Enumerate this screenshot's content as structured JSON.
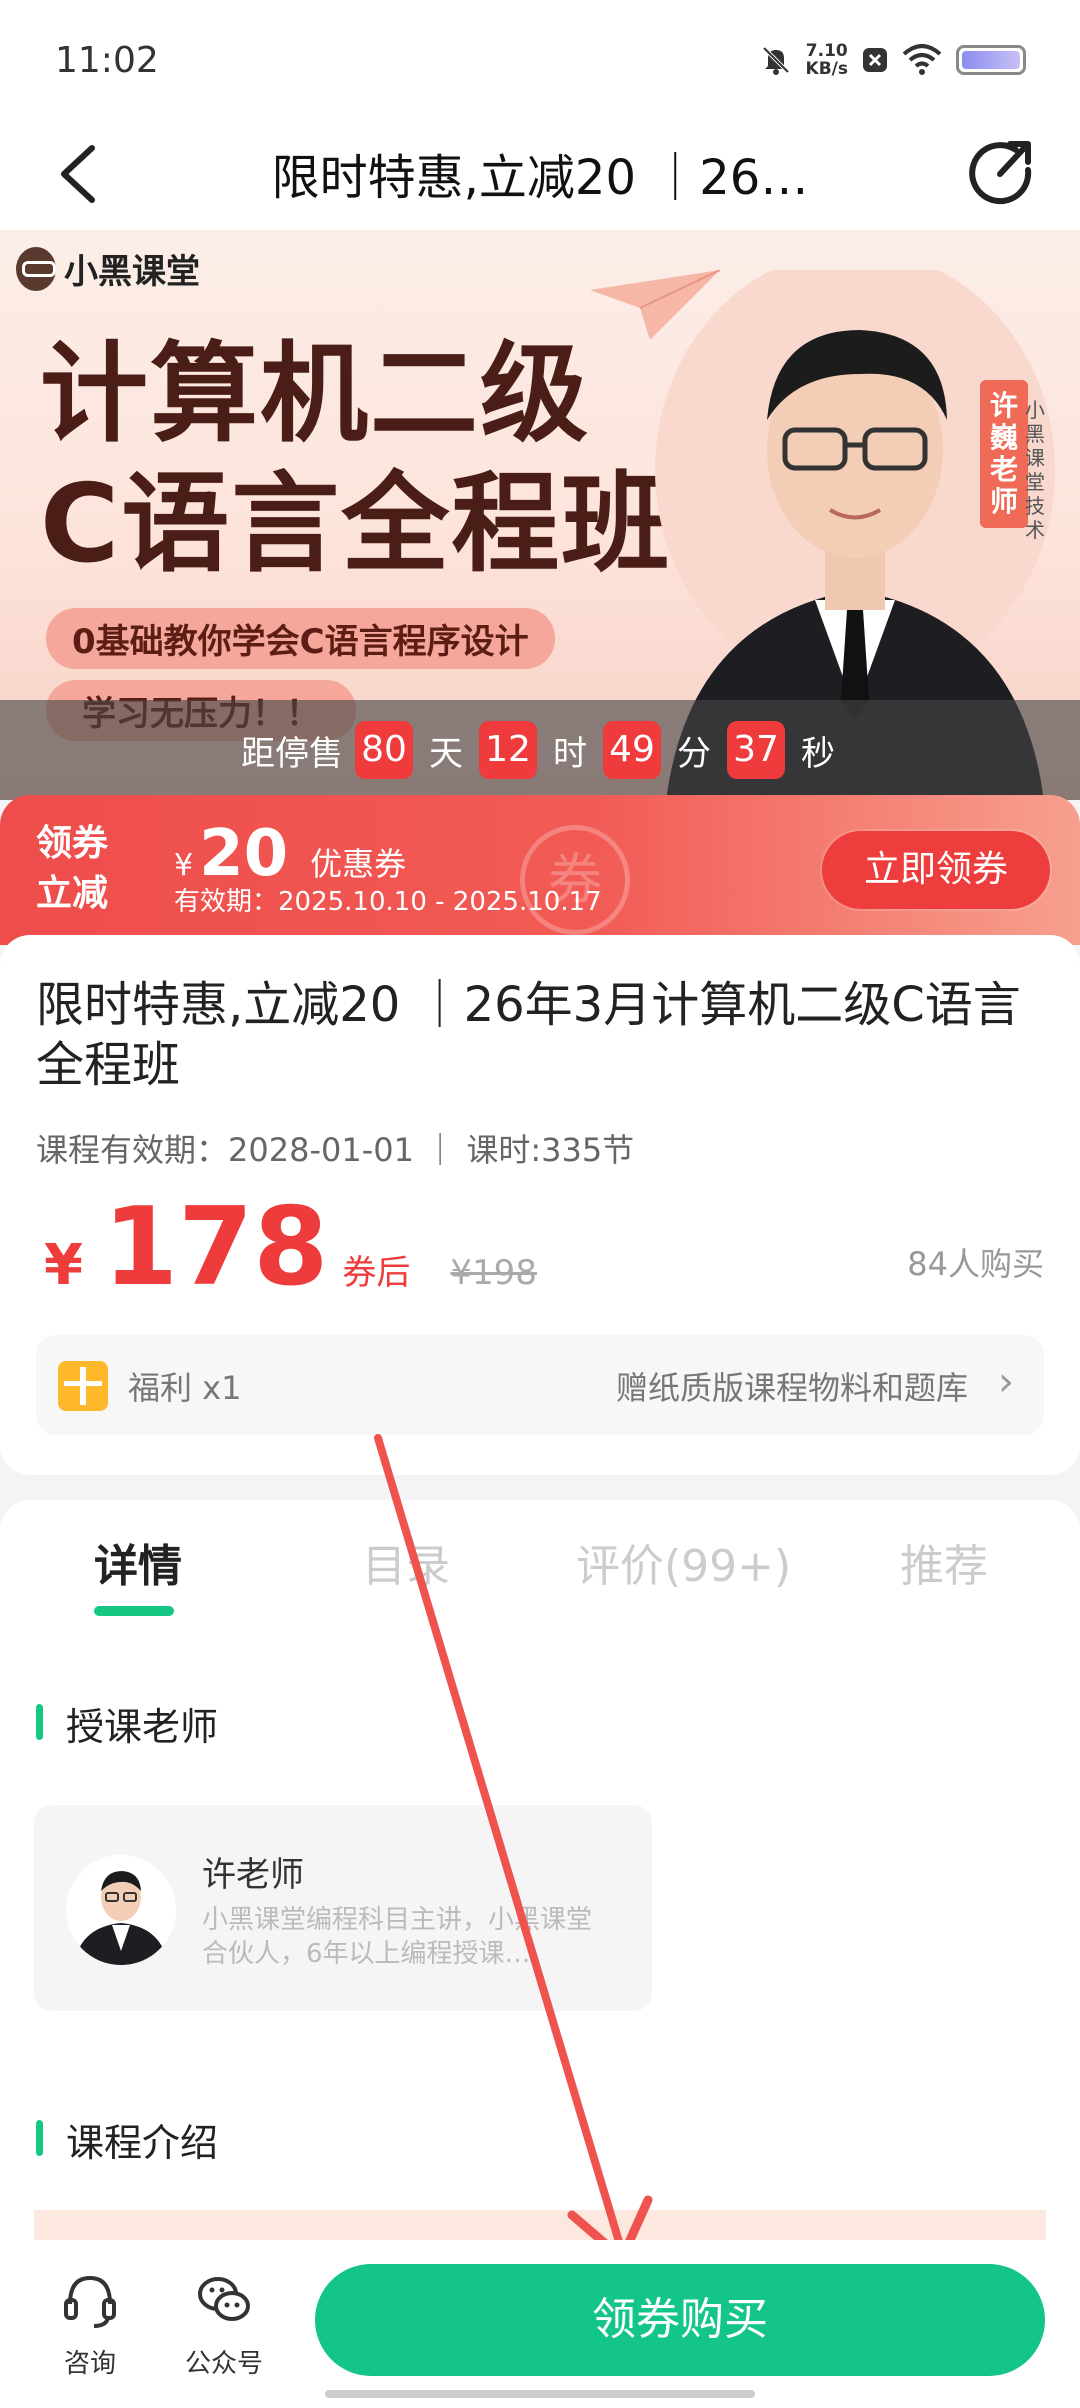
{
  "status_bar": {
    "time": "11:02",
    "net_speed_value": "7.10",
    "net_speed_unit": "KB/s"
  },
  "nav": {
    "title": "限时特惠,立减20 ｜26…"
  },
  "banner": {
    "brand": "小黑课堂",
    "headline_line1": "计算机二级",
    "headline_line2": "C语言全程班",
    "pill1": "0基础教你学会C语言程序设计",
    "pill2": "学习无压力！！",
    "teacher_tag": "许巍老师",
    "teacher_vertical": "小黑课堂技术"
  },
  "countdown": {
    "prefix": "距停售",
    "days": "80",
    "days_unit": "天",
    "hours": "12",
    "hours_unit": "时",
    "minutes": "49",
    "minutes_unit": "分",
    "seconds": "37",
    "seconds_unit": "秒"
  },
  "coupon": {
    "left_line1": "领券",
    "left_line2": "立减",
    "currency": "¥",
    "amount": "20",
    "label": "优惠券",
    "validity": "有效期：2025.10.10 - 2025.10.17",
    "stamp": "券",
    "button": "立即领券"
  },
  "course": {
    "title": "限时特惠,立减20 ｜26年3月计算机二级C语言全程班",
    "meta": "课程有效期：2028-01-01 ｜ 课时:335节",
    "price_symbol": "¥",
    "price": "178",
    "price_suffix": "券后",
    "original_price": "¥198",
    "buyers": "84人购买",
    "welfare_label": "福利 x1",
    "welfare_desc": "赠纸质版课程物料和题库",
    "welfare_arrow": "›"
  },
  "tabs": [
    {
      "label": "详情",
      "active": true
    },
    {
      "label": "目录",
      "active": false
    },
    {
      "label": "评价(99+)",
      "active": false
    },
    {
      "label": "推荐",
      "active": false
    }
  ],
  "sections": {
    "teacher": "授课老师",
    "intro": "课程介绍"
  },
  "teacher": {
    "name": "许老师",
    "desc": "小黑课堂编程科目主讲，小黑课堂合伙人，6年以上编程授课…"
  },
  "bottom_bar": {
    "consult": "咨询",
    "official": "公众号",
    "buy": "领券购买"
  },
  "colors": {
    "accent_green": "#13c586",
    "price_red": "#ee3b3b",
    "coupon_red": "#ee4d4b",
    "annotation_arrow": "#f0524e"
  }
}
